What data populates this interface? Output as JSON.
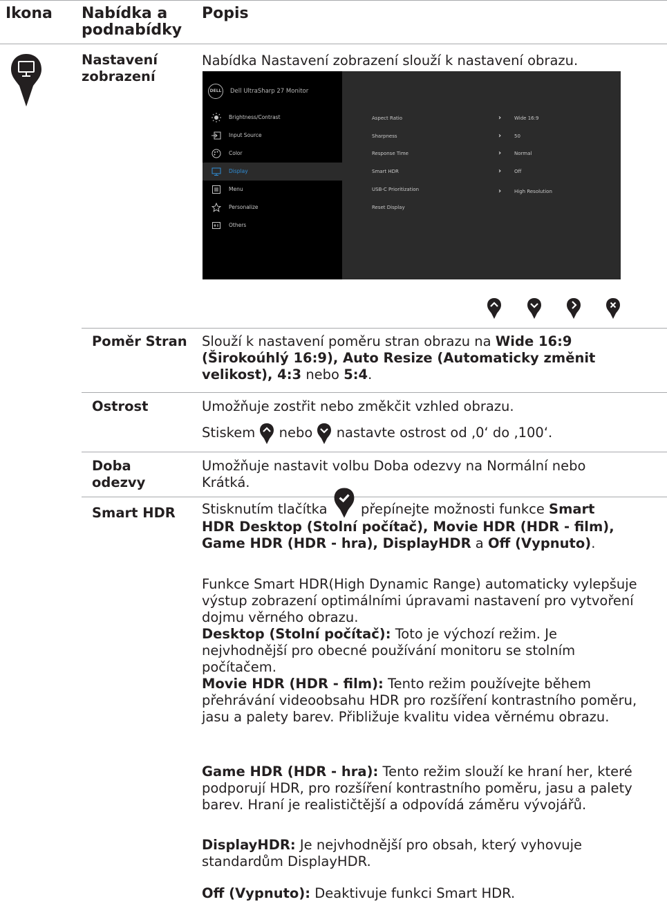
{
  "header": {
    "col_icon": "Ikona",
    "col_menu_line1": "Nabídka a",
    "col_menu_line2": "podnabídky",
    "col_desc": "Popis"
  },
  "section": {
    "title_line1": "Nastavení",
    "title_line2": "zobrazení",
    "intro": "Nabídka Nastavení zobrazení slouží k nastavení obrazu.",
    "icon": "monitor-icon"
  },
  "osd": {
    "title": "Dell UltraSharp 27 Monitor",
    "logo": "DELL",
    "menu": [
      {
        "label": "Brightness/Contrast",
        "icon": "brightness-icon"
      },
      {
        "label": "Input Source",
        "icon": "input-source-icon"
      },
      {
        "label": "Color",
        "icon": "color-icon"
      },
      {
        "label": "Display",
        "icon": "display-icon"
      },
      {
        "label": "Menu",
        "icon": "menu-icon"
      },
      {
        "label": "Personalize",
        "icon": "star-icon"
      },
      {
        "label": "Others",
        "icon": "others-icon"
      }
    ],
    "settings": [
      {
        "label": "Aspect Ratio",
        "value": "Wide 16:9"
      },
      {
        "label": "Sharpness",
        "value": "50"
      },
      {
        "label": "Response Time",
        "value": "Normal"
      },
      {
        "label": "Smart HDR",
        "value": "Off"
      },
      {
        "label": "USB-C Prioritization",
        "value": "High Resolution"
      },
      {
        "label": "Reset Display",
        "value": ""
      }
    ],
    "buttons": [
      "up-icon",
      "down-icon",
      "right-icon",
      "close-icon"
    ]
  },
  "rows": {
    "aspect": {
      "label": "Poměr Stran",
      "t1": "Slouží k nastavení poměru stran obrazu na ",
      "b1": "Wide 16:9 (Širokoúhlý 16:9), Auto Resize (Automaticky změnit velikost), 4:3",
      "t2": " nebo ",
      "b2": "5:4",
      "t3": "."
    },
    "sharpness": {
      "label": "Ostrost",
      "line1": "Umožňuje zostřit nebo změkčit vzhled obrazu.",
      "pre": "Stiskem",
      "mid": "nebo",
      "post": "nastavte ostrost od ‚0‘ do ‚100‘."
    },
    "response": {
      "label_line1": "Doba",
      "label_line2": "odezvy",
      "line1": "Umožňuje nastavit volbu Doba odezvy na Normální nebo",
      "line2": "Krátká."
    },
    "smarthdr": {
      "label": "Smart HDR",
      "p1_pre": "Stisknutím tlačítka",
      "p1_post": "přepínejte možnosti funkce",
      "p1_b1": "Smart",
      "p1_b2": "HDR Desktop (Stolní počítač), Movie HDR (HDR - film),",
      "p1_b3": "Game HDR (HDR - hra), DisplayHDR",
      "p1_and": "a",
      "p1_b4": "Off (Vypnuto)",
      "p1_end": ".",
      "p2": "Funkce Smart HDR(High Dynamic Range) automaticky vylepšuje výstup zobrazení optimálními úpravami nastavení pro vytvoření dojmu věrného obrazu.",
      "desktop_b": "Desktop (Stolní počítač):",
      "desktop_t": " Toto je výchozí režim. Je nejvhodnější pro obecné používání monitoru se stolním počítačem.",
      "movie_b": "Movie HDR (HDR - film):",
      "movie_t": " Tento režim používejte během přehrávání videoobsahu HDR pro rozšíření kontrastního poměru, jasu a palety barev. Přibližuje kvalitu videa věrnému obrazu.",
      "game_b": "Game HDR (HDR - hra):",
      "game_t": " Tento režim slouží ke hraní her, které podporují HDR, pro rozšíření kontrastního poměru, jasu a palety barev. Hraní je realističtější a odpovídá záměru vývojářů.",
      "dhdr_b": "DisplayHDR:",
      "dhdr_t": " Je nejvhodnější pro obsah, který vyhovuje standardům DisplayHDR.",
      "off_b": "Off (Vypnuto):",
      "off_t": " Deaktivuje funkci Smart HDR."
    }
  },
  "colors": {
    "accent": "#2f8fd8",
    "rule": "#a7a9ac",
    "text": "#231f20",
    "osd_bg": "#000000"
  }
}
